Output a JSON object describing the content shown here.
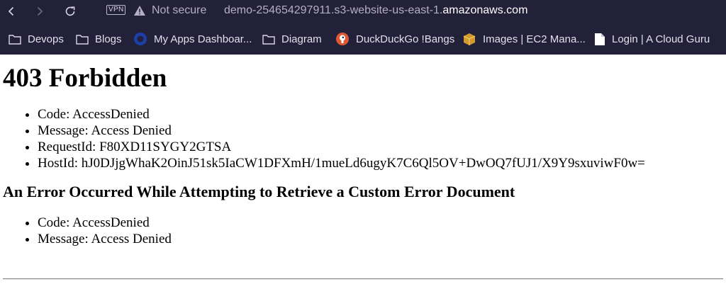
{
  "browser": {
    "vpn_badge": "VPN",
    "security_label": "Not secure",
    "url_prefix": "demo-254654297911.s3-website-us-east-1.",
    "url_domain": "amazonaws.com",
    "bookmarks": [
      {
        "label": "Devops",
        "icon": "folder-icon"
      },
      {
        "label": "Blogs",
        "icon": "folder-icon"
      },
      {
        "label": "My Apps Dashboar...",
        "icon": "okta-icon"
      },
      {
        "label": "Diagram",
        "icon": "folder-icon"
      },
      {
        "label": "DuckDuckGo !Bangs",
        "icon": "duckduckgo-icon"
      },
      {
        "label": "Images | EC2 Mana...",
        "icon": "aws-box-icon"
      },
      {
        "label": "Login | A Cloud Guru",
        "icon": "document-icon"
      }
    ],
    "colors": {
      "chrome_bg": "#23203a",
      "text": "#d8d6e4",
      "url_dim": "#b3b0c4"
    }
  },
  "page": {
    "title": "403 Forbidden",
    "details": [
      "Code: AccessDenied",
      "Message: Access Denied",
      "RequestId: F80XD11SYGY2GTSA",
      "HostId: hJ0DJjgWhaK2OinJ51sk5IaCW1DFXmH/1mueLd6ugyK7C6Ql5OV+DwOQ7fUJ1/X9Y9sxuviwF0w="
    ],
    "custom_error_heading": "An Error Occurred While Attempting to Retrieve a Custom Error Document",
    "custom_error_details": [
      "Code: AccessDenied",
      "Message: Access Denied"
    ]
  }
}
